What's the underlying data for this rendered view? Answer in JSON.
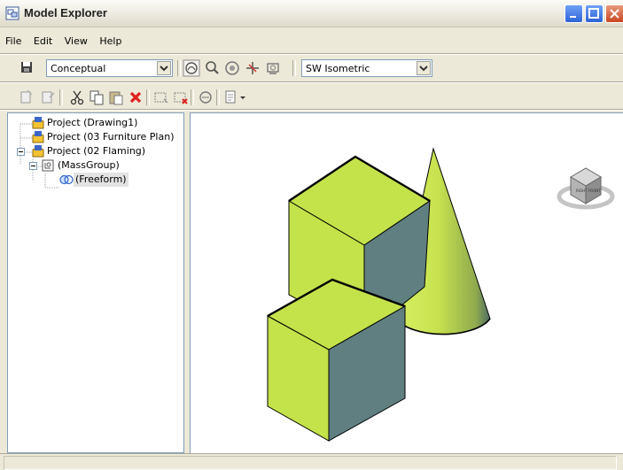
{
  "window": {
    "title": "Model Explorer",
    "title_bar_color": "#ece9d8"
  },
  "menu": {
    "items": [
      "File",
      "Edit",
      "View",
      "Help"
    ]
  },
  "toolbar": {
    "visual_style": "Conceptual",
    "view_preset": "SW Isometric"
  },
  "tree": {
    "items": [
      {
        "label": "Project (Drawing1)",
        "icon": "project-icon"
      },
      {
        "label": "Project (03 Furniture Plan)",
        "icon": "project-icon"
      },
      {
        "label": "Project (02 Flaming)",
        "icon": "project-icon"
      },
      {
        "label": "(MassGroup)",
        "icon": "mass-group-icon"
      },
      {
        "label": "(Freeform)",
        "icon": "freeform-icon"
      }
    ]
  },
  "viewport": {
    "model_colors": {
      "lit_face": "#c4e24a",
      "shaded_face": "#5f7f80",
      "cone_dark": "#4f7060"
    },
    "viewcube_faces": [
      "RIGHT",
      "FRONT"
    ]
  }
}
